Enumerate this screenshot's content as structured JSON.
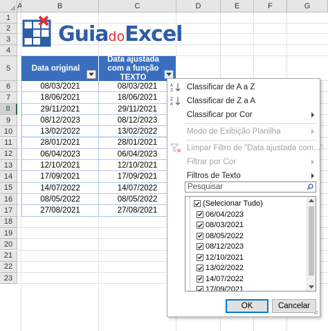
{
  "columns": [
    "A",
    "B",
    "C",
    "D",
    "E",
    "F",
    "G"
  ],
  "rows": [
    "1",
    "2",
    "3",
    "4",
    "5",
    "6",
    "7",
    "8",
    "9",
    "10",
    "11",
    "12",
    "13",
    "14",
    "15",
    "16",
    "17",
    "18",
    "19",
    "20",
    "21",
    "22",
    "23"
  ],
  "logo": {
    "part1": "Guia",
    "part2": "do",
    "part3": "Excel",
    "colors": {
      "blue": "#2e5da8",
      "red": "#e0302f"
    }
  },
  "table": {
    "headers": [
      "Data original",
      "Data ajustada com a função TEXTO"
    ],
    "rows": [
      [
        "08/03/2021",
        "08/03/2021"
      ],
      [
        "18/06/2021",
        "18/06/2021"
      ],
      [
        "29/11/2021",
        "29/11/2021"
      ],
      [
        "08/12/2023",
        "08/12/2023"
      ],
      [
        "13/02/2022",
        "13/02/2022"
      ],
      [
        "28/01/2021",
        "28/01/2021"
      ],
      [
        "06/04/2023",
        "06/04/2023"
      ],
      [
        "12/10/2021",
        "12/10/2021"
      ],
      [
        "17/09/2021",
        "17/09/2021"
      ],
      [
        "14/07/2022",
        "14/07/2022"
      ],
      [
        "08/05/2022",
        "08/05/2022"
      ],
      [
        "27/08/2021",
        "27/08/2021"
      ]
    ],
    "header_color": "#3a6fbf"
  },
  "menu": {
    "sort_az": "Classificar de A a Z",
    "sort_za": "Classificar de Z a A",
    "sort_color": "Classificar por Cor",
    "sheet_view": "Modo de Exibição Planilha",
    "clear_filter": "Limpar Filtro de \"Data ajustada com...\"",
    "filter_color": "Filtrar por Cor",
    "text_filters": "Filtros de Texto",
    "search_placeholder": "Pesquisar",
    "items": [
      "(Selecionar Tudo)",
      "06/04/2023",
      "08/03/2021",
      "08/05/2022",
      "08/12/2023",
      "12/10/2021",
      "13/02/2022",
      "14/07/2022",
      "17/09/2021"
    ],
    "ok": "OK",
    "cancel": "Cancelar"
  }
}
